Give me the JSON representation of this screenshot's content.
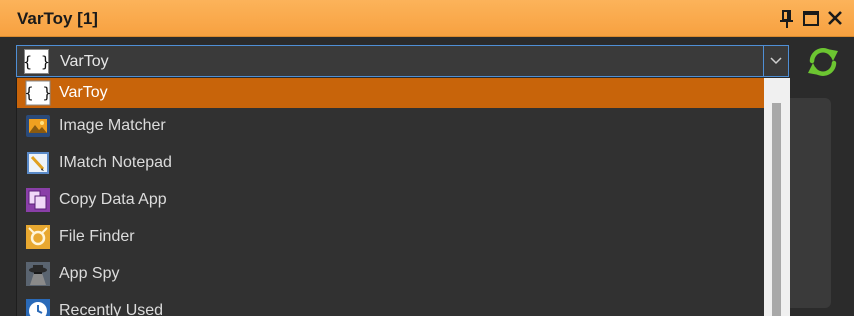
{
  "window": {
    "title": "VarToy [1]",
    "accent_color": "#f7a140",
    "selected_color": "#c8640a"
  },
  "title_buttons": {
    "pin_icon": "pin-icon",
    "maximize_icon": "maximize-icon",
    "close_icon": "close-icon"
  },
  "combo": {
    "selected_label": "VarToy",
    "selected_icon": "braces-icon"
  },
  "refresh_icon": "refresh-icon",
  "dropdown": {
    "items": [
      {
        "label": "VarToy",
        "icon": "braces-icon",
        "selected": true
      },
      {
        "label": "Image Matcher",
        "icon": "image-matcher-icon",
        "selected": false
      },
      {
        "label": "IMatch Notepad",
        "icon": "notepad-icon",
        "selected": false
      },
      {
        "label": "Copy Data App",
        "icon": "copy-data-icon",
        "selected": false
      },
      {
        "label": "File Finder",
        "icon": "file-finder-icon",
        "selected": false
      },
      {
        "label": "App Spy",
        "icon": "app-spy-icon",
        "selected": false
      },
      {
        "label": "Recently Used",
        "icon": "recently-used-icon",
        "selected": false
      }
    ]
  }
}
